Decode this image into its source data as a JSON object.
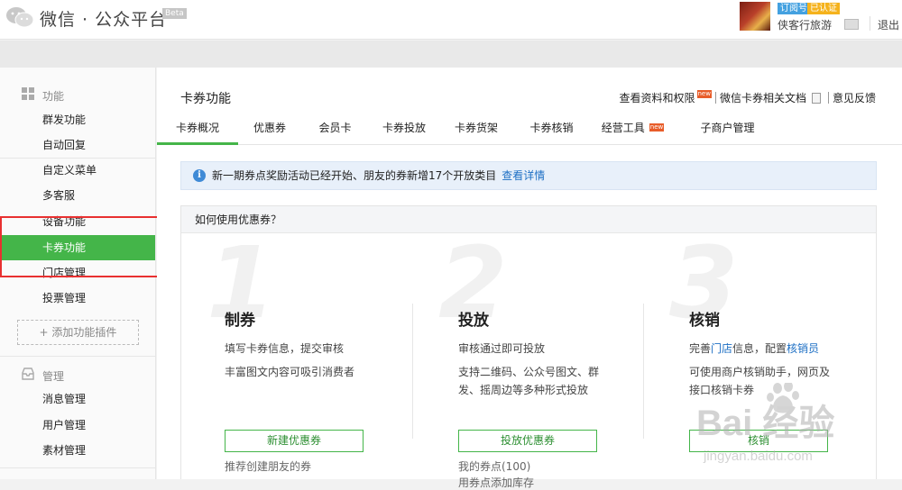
{
  "header": {
    "brand": "微信 · 公众平台",
    "beta": "Beta",
    "badge_type": "订阅号",
    "badge_verified": "已认证",
    "account_name": "侠客行旅游",
    "logout": "退出"
  },
  "sidebar": {
    "section_function": "功能",
    "items": [
      "群发功能",
      "自动回复",
      "自定义菜单",
      "多客服",
      "设备功能",
      "卡券功能",
      "门店管理",
      "投票管理"
    ],
    "add_plugin": "添加功能插件",
    "section_manage": "管理",
    "manage_items": [
      "消息管理",
      "用户管理",
      "素材管理"
    ]
  },
  "main": {
    "title": "卡券功能",
    "links": {
      "view_permissions": "查看资料和权限",
      "docs": "微信卡券相关文档",
      "feedback": "意见反馈",
      "new_tag": "new"
    },
    "tabs": [
      "卡券概况",
      "优惠券",
      "会员卡",
      "卡券投放",
      "卡券货架",
      "卡券核销",
      "经营工具",
      "子商户管理"
    ],
    "notice": {
      "text": "新一期券点奖励活动已经开始、朋友的券新增17个开放类目",
      "link": "查看详情"
    },
    "panel_title": "如何使用优惠券？",
    "steps": [
      {
        "num": "1",
        "title": "制券",
        "line1": "填写卡券信息，提交审核",
        "line2": "丰富图文内容可吸引消费者",
        "button": "新建优惠券",
        "sub1": "推荐创建朋友的券"
      },
      {
        "num": "2",
        "title": "投放",
        "line1": "审核通过即可投放",
        "line2": "支持二维码、公众号图文、群发、摇周边等多种形式投放",
        "button": "投放优惠券",
        "sub1": "我的券点(100)",
        "sub2": "用券点添加库存"
      },
      {
        "num": "3",
        "title": "核销",
        "line1_pre": "完善",
        "line1_link1": "门店",
        "line1_mid": "信息，配置",
        "line1_link2": "核销员",
        "line2": "可使用商户核销助手，网页及接口核销卡券",
        "button": "核销"
      }
    ]
  },
  "watermark": {
    "text": "Bai 经验",
    "url": "jingyan.baidu.com"
  },
  "colors": {
    "accent_green": "#44b549",
    "link_blue": "#1d6fc4",
    "highlight_red": "#e83030"
  }
}
